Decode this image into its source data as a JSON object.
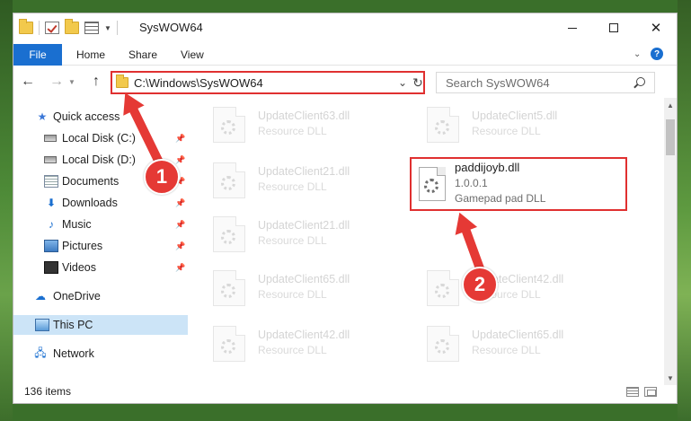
{
  "window": {
    "title": "SysWOW64"
  },
  "ribbon": {
    "file": "File",
    "home": "Home",
    "share": "Share",
    "view": "View"
  },
  "address": {
    "path": "C:\\Windows\\SysWOW64"
  },
  "search": {
    "placeholder": "Search SysWOW64"
  },
  "sidebar": {
    "items": [
      {
        "label": "Quick access"
      },
      {
        "label": "Local Disk (C:)"
      },
      {
        "label": "Local Disk (D:)"
      },
      {
        "label": "Documents"
      },
      {
        "label": "Downloads"
      },
      {
        "label": "Music"
      },
      {
        "label": "Pictures"
      },
      {
        "label": "Videos"
      },
      {
        "label": "OneDrive"
      },
      {
        "label": "This PC"
      },
      {
        "label": "Network"
      }
    ]
  },
  "files": [
    {
      "name": "UpdateClient63.dll",
      "type": "Resource DLL"
    },
    {
      "name": "UpdateClient5.dll",
      "type": "Resource DLL"
    },
    {
      "name": "UpdateClient21.dll",
      "type": "Resource DLL"
    },
    {
      "name": "UpdateClient21.dll",
      "type": "Resource DLL"
    },
    {
      "name": "UpdateClient65.dll",
      "type": "Resource DLL"
    },
    {
      "name": "UpdateClient42.dll",
      "type": "Resource DLL"
    },
    {
      "name": "UpdateClient42.dll",
      "type": "Resource DLL"
    },
    {
      "name": "UpdateClient65.dll",
      "type": "Resource DLL"
    }
  ],
  "highlighted_file": {
    "name": "paddijoyb.dll",
    "version": "1.0.0.1",
    "type": "Gamepad pad DLL"
  },
  "status": {
    "count": "136 items"
  },
  "annotations": {
    "step1": "1",
    "step2": "2"
  },
  "colors": {
    "accent": "#1a6fd0",
    "highlight": "#e03030",
    "selected": "#cce4f7"
  }
}
